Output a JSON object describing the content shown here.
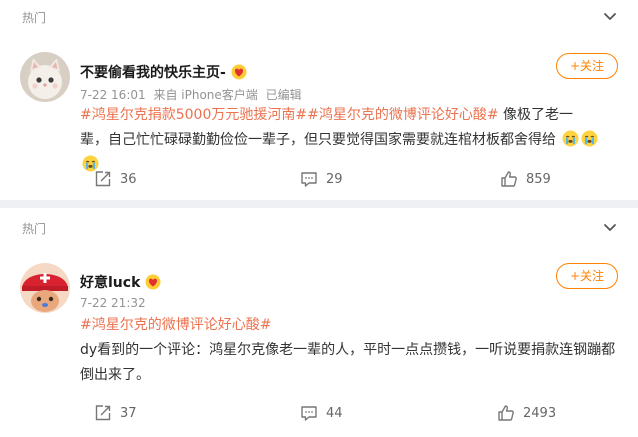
{
  "colors": {
    "accent": "#ff8200",
    "hashtag": "#eb7350",
    "meta": "#939393"
  },
  "posts": [
    {
      "section_label": "热门",
      "username": "不要偷看我的快乐主页-",
      "meta": {
        "time": "7-22 16:01",
        "source": "来自 iPhone客户端",
        "edited": "已编辑"
      },
      "follow_label": "关注",
      "hashtags": [
        "#鸿星尔克捐款5000万元驰援河南#",
        "#鸿星尔克的微博评论好心酸#"
      ],
      "body": "像极了老一辈，自己忙忙碌碌勤勤俭俭一辈子，但只要觉得国家需要就连棺材板都舍得给",
      "emoji": [
        "crying-face-icon",
        "crying-face-icon",
        "crying-face-icon"
      ],
      "actions": {
        "repost": "36",
        "comment": "29",
        "like": "859"
      }
    },
    {
      "section_label": "热门",
      "username": "好意luck",
      "meta": {
        "time": "7-22 21:32"
      },
      "follow_label": "关注",
      "hashtags": [
        "#鸿星尔克的微博评论好心酸#"
      ],
      "body_line1": "dy看到的一个评论：鸿星尔克像老一辈的人，平时一点点攒钱，一听说要捐款连钢蹦都",
      "body_line2": "倒出来了。",
      "actions": {
        "repost": "37",
        "comment": "44",
        "like": "2493"
      }
    }
  ]
}
